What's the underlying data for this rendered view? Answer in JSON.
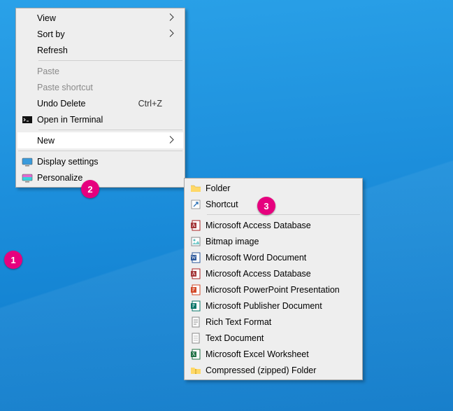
{
  "primary_menu": {
    "view": "View",
    "sort_by": "Sort by",
    "refresh": "Refresh",
    "paste": "Paste",
    "paste_shortcut": "Paste shortcut",
    "undo_delete": "Undo Delete",
    "undo_delete_accel": "Ctrl+Z",
    "open_terminal": "Open in Terminal",
    "new": "New",
    "display_settings": "Display settings",
    "personalize": "Personalize"
  },
  "new_menu": {
    "folder": "Folder",
    "shortcut": "Shortcut",
    "access_db": "Microsoft Access Database",
    "bitmap": "Bitmap image",
    "word": "Microsoft Word Document",
    "access_db2": "Microsoft Access Database",
    "powerpoint": "Microsoft PowerPoint Presentation",
    "publisher": "Microsoft Publisher Document",
    "rtf": "Rich Text Format",
    "text": "Text Document",
    "excel": "Microsoft Excel Worksheet",
    "zip": "Compressed (zipped) Folder"
  },
  "badges": {
    "b1": "1",
    "b2": "2",
    "b3": "3"
  }
}
